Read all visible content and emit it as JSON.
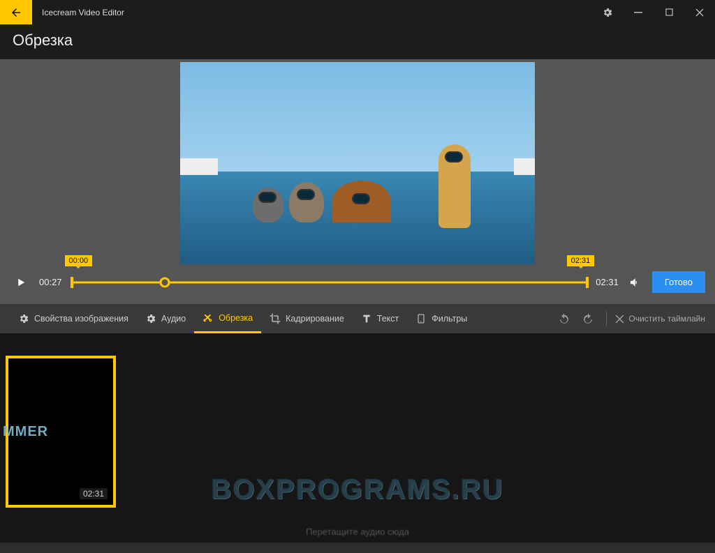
{
  "titlebar": {
    "app_name": "Icecream Video Editor"
  },
  "page": {
    "title": "Обрезка"
  },
  "preview": {
    "current_time": "00:27",
    "duration": "02:31",
    "trim_start": "00:00",
    "trim_end": "02:31",
    "playhead_pct": 18,
    "done_label": "Готово"
  },
  "tools": {
    "image_props": "Свойства изображения",
    "audio": "Аудио",
    "trim": "Обрезка",
    "crop": "Кадрирование",
    "text": "Текст",
    "filters": "Фильтры"
  },
  "toolbar": {
    "clear_timeline": "Очистить таймлайн"
  },
  "timeline": {
    "clips": [
      {
        "thumb_text": "MMER",
        "duration": "02:31"
      }
    ],
    "audio_hint": "Перетащите аудио сюда"
  },
  "watermark": "BOXPROGRAMS.RU"
}
